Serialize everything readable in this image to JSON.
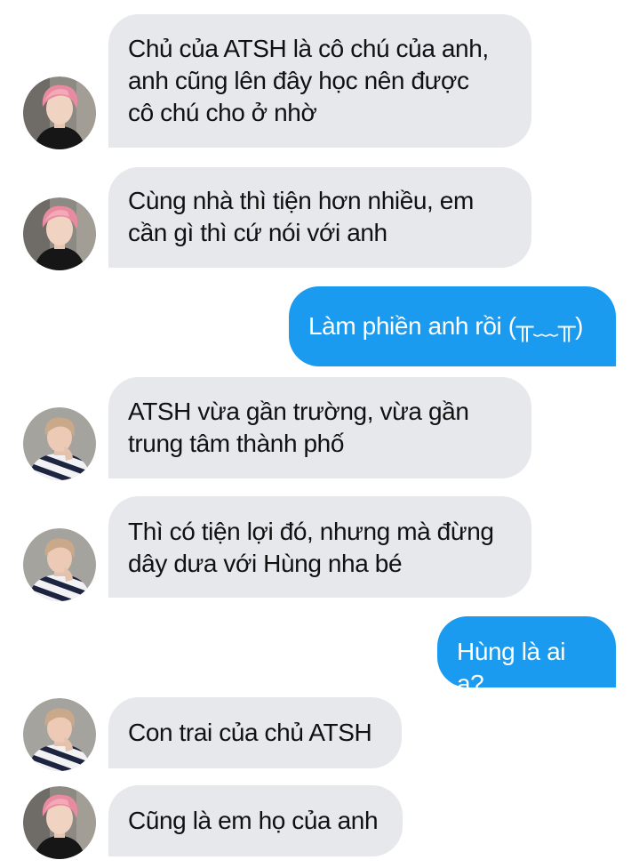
{
  "messages": [
    {
      "text": "Chủ của ATSH là cô chú của anh,\nanh cũng lên đây học nên được\ncô chú cho ở nhờ",
      "sender": "pink-hair-contact"
    },
    {
      "text": "Cùng nhà thì tiện hơn nhiều, em\ncần gì thì cứ nói với anh",
      "sender": "pink-hair-contact"
    },
    {
      "text": "Làm phiền anh rồi (╥﹏╥)",
      "sender": "me"
    },
    {
      "text": "ATSH vừa gần trường, vừa gần\ntrung tâm thành phố",
      "sender": "striped-sweater-contact"
    },
    {
      "text": "Thì có tiện lợi đó, nhưng mà đừng\ndây dưa với Hùng nha bé",
      "sender": "striped-sweater-contact"
    },
    {
      "text": "Hùng là ai ạ?",
      "sender": "me"
    },
    {
      "text": "Con trai của chủ ATSH",
      "sender": "striped-sweater-contact"
    },
    {
      "text": "Cũng là em họ của anh",
      "sender": "pink-hair-contact"
    }
  ],
  "colors": {
    "incoming_bubble": "#e6e8ec",
    "outgoing_bubble": "#1a9bef",
    "incoming_text": "#111111",
    "outgoing_text": "#ffffff"
  }
}
